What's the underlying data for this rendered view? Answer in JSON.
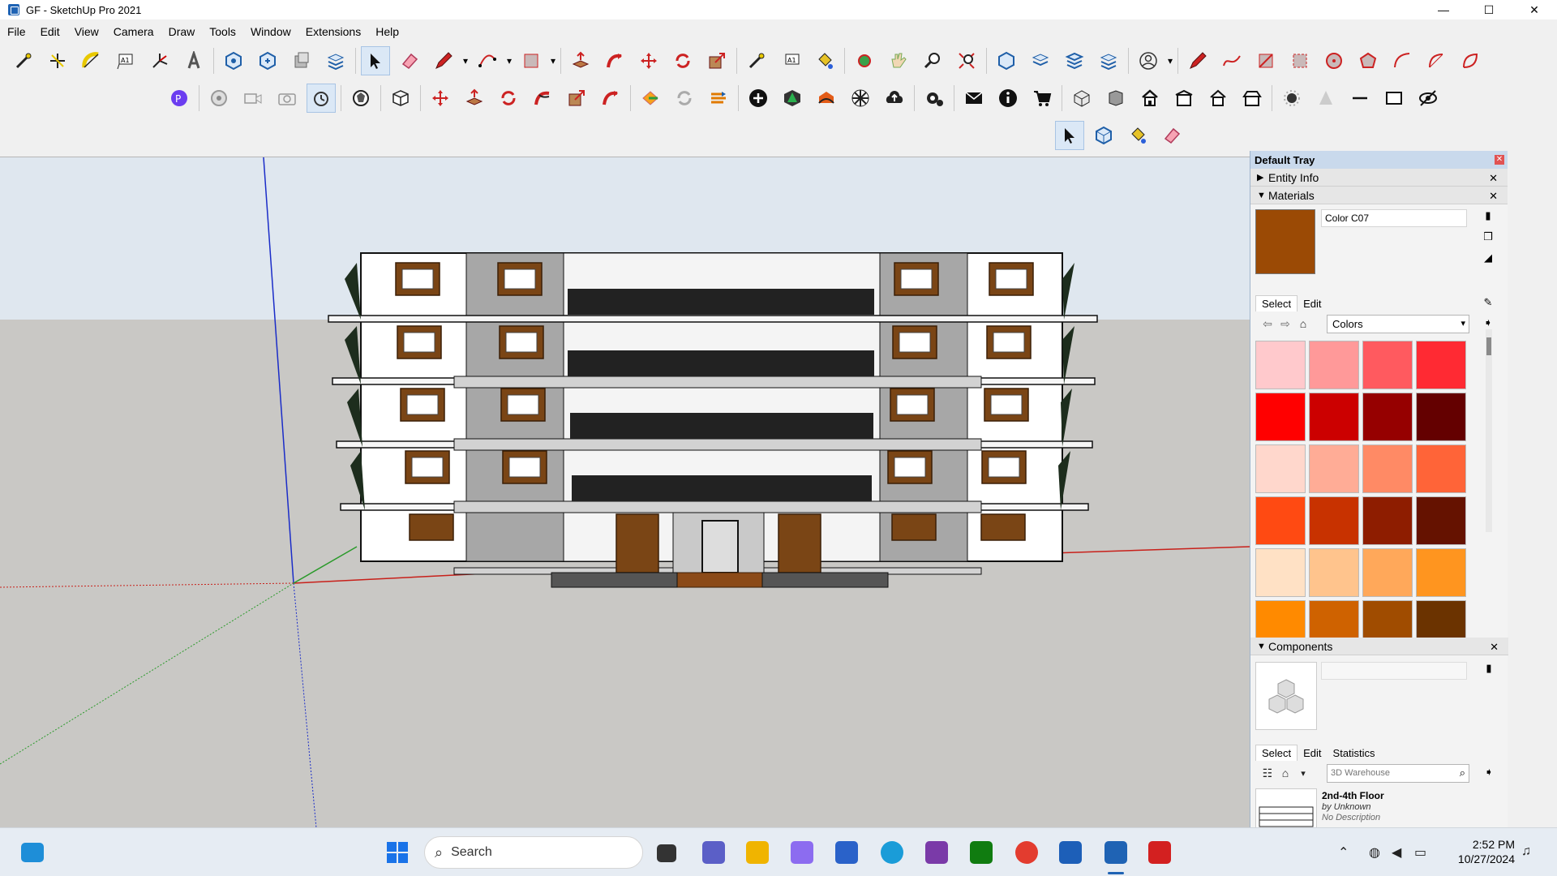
{
  "window": {
    "title": "GF - SketchUp Pro 2021",
    "controls": [
      "—",
      "☐",
      "✕"
    ]
  },
  "menu": [
    "File",
    "Edit",
    "View",
    "Camera",
    "Draw",
    "Tools",
    "Window",
    "Extensions",
    "Help"
  ],
  "toolbar": {
    "row1": [
      "select-tool-icon",
      "eraser-icon",
      "pencil-icon",
      "arc-icon",
      "rectangle-icon",
      "push-pull-icon",
      "follow-me-icon",
      "move-icon",
      "rotate-icon",
      "scale-icon",
      "tape-measure-icon",
      "text-icon",
      "paint-bucket-icon",
      "orbit-icon",
      "pan-icon",
      "zoom-icon",
      "zoom-extents-icon"
    ],
    "row2": [
      "warehouse-icon",
      "camera-icon",
      "walk-icon",
      "look-around-icon",
      "component-icon",
      "move-icon",
      "rotate-icon",
      "offset-icon",
      "3d-warehouse-icon",
      "extension-warehouse-icon",
      "settings-icon",
      "mail-icon",
      "info-icon",
      "cart-icon",
      "house-icon"
    ],
    "row3": [
      "select-icon",
      "make-component-icon",
      "paint-bucket-icon",
      "eraser-icon"
    ]
  },
  "tray": {
    "title": "Default Tray",
    "entity_info": {
      "label": "Entity Info",
      "caret": "▶"
    },
    "materials": {
      "label": "Materials",
      "caret": "▼",
      "current_name": "Color C07",
      "current_color": "#9b4a05",
      "tabs": [
        "Select",
        "Edit"
      ],
      "library": "Colors",
      "swatches": [
        "#ffc9cc",
        "#ff9999",
        "#ff5a5f",
        "#ff2a33",
        "#ff0000",
        "#cc0000",
        "#960000",
        "#640000",
        "#ffd7cc",
        "#ffac96",
        "#ff8a65",
        "#ff6438",
        "#ff4a12",
        "#c83200",
        "#8e1d00",
        "#651200",
        "#ffe1c5",
        "#ffc48d",
        "#ffa85a",
        "#ff951f",
        "#ff8a00",
        "#cf6200",
        "#a04c00",
        "#6b3300"
      ]
    },
    "components": {
      "label": "Components",
      "caret": "▼",
      "tabs": [
        "Select",
        "Edit",
        "Statistics"
      ],
      "search_placeholder": "3D Warehouse",
      "result_title": "2nd-4th Floor",
      "result_author": "by Unknown",
      "result_desc": "No Description"
    }
  },
  "taskbar": {
    "search_label": "Search",
    "time": "2:52 PM",
    "date": "10/27/2024"
  }
}
